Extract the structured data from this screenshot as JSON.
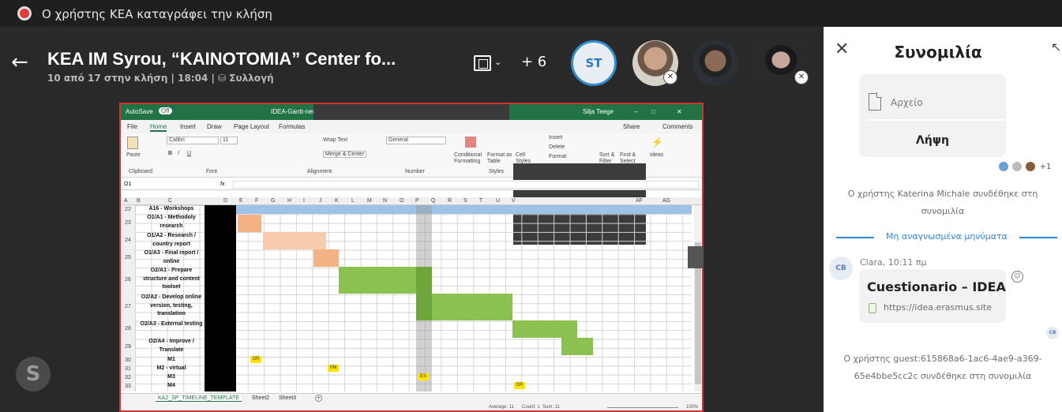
{
  "recording": {
    "text": "Ο χρήστης ΚΕΑ καταγράφει την κλήση"
  },
  "call": {
    "title": "KEA IM Syrou, “KAINOTOMIA” Center fo...",
    "subtitle": "10 από 17 στην κλήση | 18:04 | ⛁ Συλλογή",
    "more_participants": "+ 6",
    "participants": [
      {
        "initials": "ST",
        "muted": false
      },
      {
        "initials": "",
        "muted": true
      },
      {
        "initials": "",
        "muted": false
      },
      {
        "initials": "",
        "muted": true
      }
    ]
  },
  "spreadsheet": {
    "autosave": "AutoSave",
    "autosave_state": "Off",
    "filename": "IDEA-Gantt-new",
    "user": "Silja Teege",
    "menu_tabs": [
      "File",
      "Home",
      "Insert",
      "Draw",
      "Page Layout",
      "Formulas"
    ],
    "active_tab": "Home",
    "share_label": "Share",
    "comments_label": "Comments",
    "ribbon": {
      "paste": "Paste",
      "clipboard": "Clipboard",
      "font_name": "Calibri",
      "font_size": "11",
      "font_group": "Font",
      "wrap": "Wrap Text",
      "merge": "Merge & Center",
      "alignment": "Alignment",
      "number_format": "General",
      "number": "Number",
      "cond_format": "Conditional Formatting",
      "format_table": "Format as Table",
      "cell_styles": "Cell Styles",
      "styles": "Styles",
      "insert": "Insert",
      "delete": "Delete",
      "format": "Format",
      "sort": "Sort & Filter",
      "find": "Find & Select",
      "ideas": "Ideas"
    },
    "name_box": "O1",
    "columns": [
      "A",
      "B",
      "C",
      "D",
      "E",
      "F",
      "G",
      "H",
      "I",
      "J",
      "K",
      "L",
      "M",
      "N",
      "O",
      "P",
      "Q",
      "R",
      "S",
      "T",
      "U",
      "V",
      "AF",
      "AG"
    ],
    "rows": [
      {
        "num": "22",
        "task": "A16 - Workshops"
      },
      {
        "num": "23",
        "task": "O1/A1 - Methodoly research"
      },
      {
        "num": "24",
        "task": "O1/A2 - Research / country report"
      },
      {
        "num": "25",
        "task": "O1/A3 - Final report / online"
      },
      {
        "num": "26",
        "task": "O2/A1 - Prepare structure and content toolset"
      },
      {
        "num": "27",
        "task": "O2/A2 - Develop online version, testing, translation"
      },
      {
        "num": "28",
        "task": "O2/A3 - External testing"
      },
      {
        "num": "29",
        "task": "O2/A4 - Improve / Translate"
      },
      {
        "num": "30",
        "task": "M1"
      },
      {
        "num": "31",
        "task": "M2 - virtual"
      },
      {
        "num": "32",
        "task": "M3"
      },
      {
        "num": "33",
        "task": "M4"
      }
    ],
    "milestones": [
      "GR",
      "VM",
      "ES",
      "GR"
    ],
    "sheets": [
      "KA2_SP_TIMELINE_TEMPLATE",
      "Sheet2",
      "Sheet3"
    ],
    "status": {
      "average": "Average: 11",
      "count": "Count: 1",
      "sum": "Sum: 11",
      "zoom": "100%"
    }
  },
  "chat": {
    "title": "Συνομιλία",
    "file_label": "Αρχείο",
    "download_label": "Λήψη",
    "reactions_more": "+1",
    "system_msg_1": "Ο χρήστης Katerina Michale συνδέθηκε στη συνομιλία",
    "unread_label": "Μη αναγνωσμένα μηνύματα",
    "message": {
      "author_initials": "CB",
      "meta": "Clara, 10:11 πμ",
      "title": "Cuestionario – IDEA",
      "link": "https://idea.erasmus.site"
    },
    "reader_initials": "CB",
    "system_msg_2": "Ο χρήστης guest:615868a6-1ac6-4ae9-a369-65e4bbe5cc2c συνδέθηκε στη συνομιλία"
  },
  "colors": {
    "background": "#292929",
    "record_red": "#e23b3b",
    "accent_blue": "#2f86d6",
    "excel_green": "#217346",
    "gantt_green": "#8cc152",
    "gantt_peach": "#f8cbad",
    "milestone_yellow": "#ffe500"
  }
}
